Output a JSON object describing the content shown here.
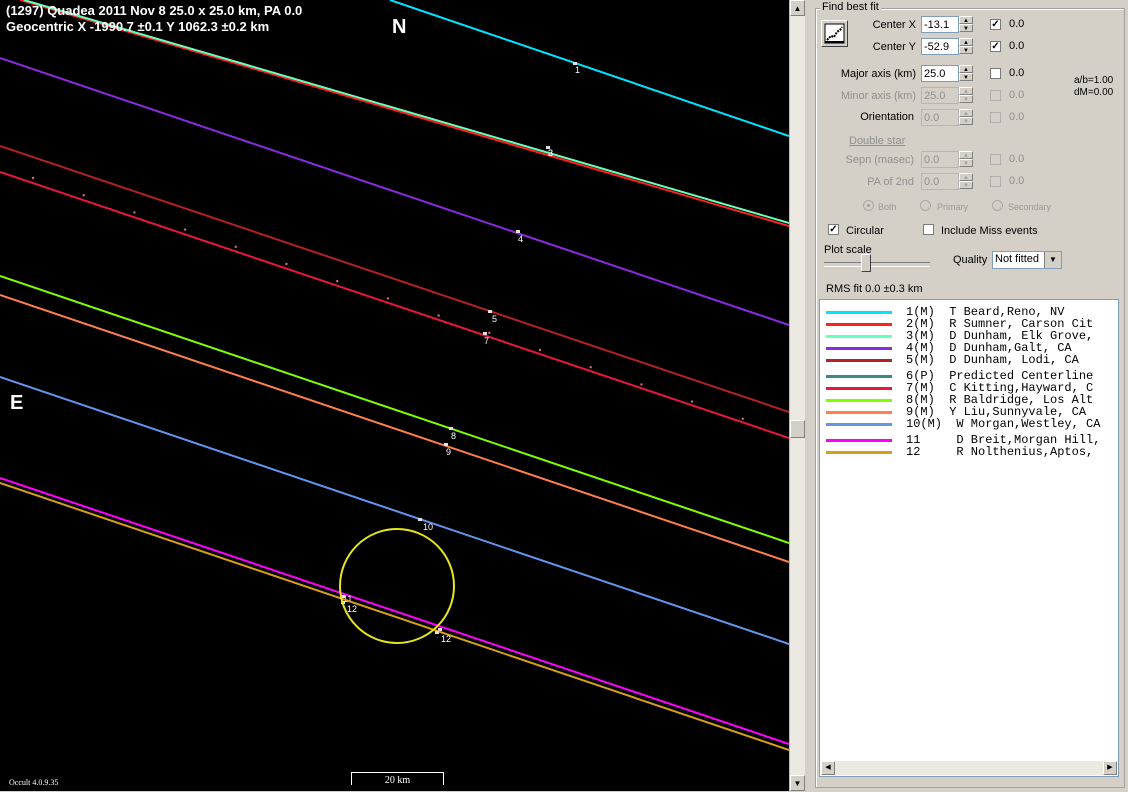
{
  "plot": {
    "header_line1": "(1297) Quadea  2011 Nov 8   25.0 x 25.0 km,  PA 0.0",
    "header_line2": "Geocentric  X  -1990.7 ±0.1  Y 1062.3 ±0.2 km",
    "north_label": "N",
    "east_label": "E",
    "version": "Occult 4.0.9.35",
    "scale_label": "20 km"
  },
  "chords": [
    {
      "n": "1",
      "color": "#00e5ff",
      "type": "solid",
      "label": "1",
      "events": [
        [
          575,
          64
        ]
      ]
    },
    {
      "n": "2",
      "color": "#ff2020",
      "type": "solid",
      "label": "2",
      "events": [
        [
          548,
          148
        ]
      ]
    },
    {
      "n": "3",
      "color": "#66ffbb",
      "type": "solid",
      "label": "3",
      "events": [
        [
          548,
          148
        ]
      ]
    },
    {
      "n": "4",
      "color": "#8a2be2",
      "type": "solid",
      "label": "4",
      "events": [
        [
          518,
          232
        ]
      ]
    },
    {
      "n": "5",
      "color": "#b22222",
      "type": "solid",
      "label": "5",
      "events": [
        [
          490,
          312
        ]
      ]
    },
    {
      "n": "6",
      "color": "#3a8a8a",
      "type": "dotted",
      "label": "",
      "events": []
    },
    {
      "n": "7",
      "color": "#e8183a",
      "type": "solid",
      "label": "7",
      "events": [
        [
          485,
          334
        ]
      ]
    },
    {
      "n": "8",
      "color": "#7fff00",
      "type": "solid",
      "label": "8",
      "events": [
        [
          451,
          429
        ]
      ]
    },
    {
      "n": "9",
      "color": "#ff7f50",
      "type": "solid",
      "label": "9",
      "events": [
        [
          446,
          445
        ]
      ]
    },
    {
      "n": "10",
      "color": "#6495ed",
      "type": "solid",
      "label": "10",
      "events": [
        [
          420,
          520
        ]
      ]
    },
    {
      "n": "11",
      "color": "#ff00ff",
      "type": "solid",
      "label": "11",
      "events": [
        [
          343,
          597
        ],
        [
          440,
          630
        ]
      ]
    },
    {
      "n": "12",
      "color": "#d4a017",
      "type": "solid",
      "label": "12",
      "events": [
        [
          343,
          603
        ],
        [
          437,
          633
        ]
      ]
    }
  ],
  "panel": {
    "group_title": "Find best fit",
    "center_x_label": "Center X",
    "center_x_value": "-13.1",
    "center_y_label": "Center Y",
    "center_y_value": "-52.9",
    "major_axis_label": "Major axis (km)",
    "major_axis_value": "25.0",
    "minor_axis_label": "Minor axis (km)",
    "minor_axis_value": "25.0",
    "orientation_label": "Orientation",
    "orientation_value": "0.0",
    "double_star_label": "Double star",
    "sepn_label": "Sepn (masec)",
    "sepn_value": "0.0",
    "pa2_label": "PA of 2nd",
    "pa2_value": "0.0",
    "fit_values": {
      "cx": "0.0",
      "cy": "0.0",
      "major": "0.0",
      "minor": "0.0",
      "orient": "0.0",
      "sepn": "0.0",
      "pa2": "0.0"
    },
    "ab_ratio": "a/b=1.00",
    "dm": "dM=0.00",
    "radio_both": "Both",
    "radio_primary": "Primary",
    "radio_secondary": "Secondary",
    "circular_label": "Circular",
    "include_miss_label": "Include Miss events",
    "plot_scale_label": "Plot scale",
    "quality_label": "Quality",
    "quality_value": "Not fitted",
    "rms_label": "RMS fit 0.0 ±0.3 km"
  },
  "observers": [
    {
      "color": "#00e5ff",
      "text": "1(M)  T Beard,Reno, NV"
    },
    {
      "color": "#ff2020",
      "text": "2(M)  R Sumner, Carson Cit"
    },
    {
      "color": "#66ffbb",
      "text": "3(M)  D Dunham, Elk Grove,"
    },
    {
      "color": "#8a2be2",
      "text": "4(M)  D Dunham,Galt, CA"
    },
    {
      "color": "#b22222",
      "text": "5(M)  D Dunham, Lodi, CA"
    },
    {
      "color": "#3a8a8a",
      "text": "6(P)  Predicted Centerline"
    },
    {
      "color": "#e8183a",
      "text": "7(M)  C Kitting,Hayward, C"
    },
    {
      "color": "#7fff00",
      "text": "8(M)  R Baldridge, Los Alt"
    },
    {
      "color": "#ff7f50",
      "text": "9(M)  Y Liu,Sunnyvale, CA"
    },
    {
      "color": "#6495ed",
      "text": "10(M)  W Morgan,Westley, CA"
    },
    {
      "color": "#ff00ff",
      "text": "11     D Breit,Morgan Hill,"
    },
    {
      "color": "#d4a017",
      "text": "12     R Nolthenius,Aptos,"
    }
  ]
}
